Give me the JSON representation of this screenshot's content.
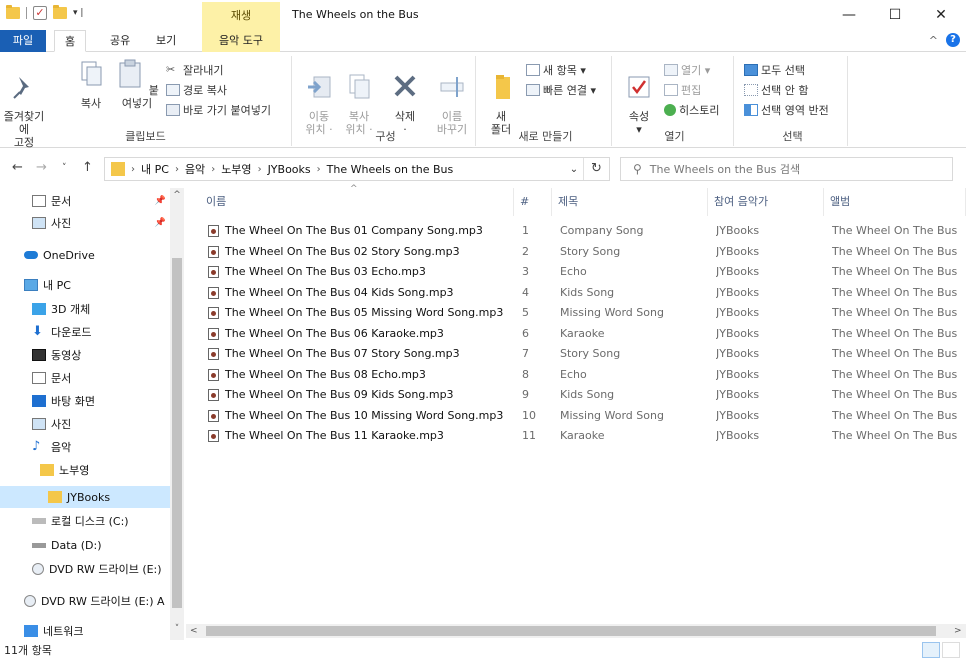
{
  "titlebar": {
    "context_tab_label": "재생",
    "title": "The Wheels on the Bus",
    "minimize": "—",
    "maximize": "☐",
    "close": "✕"
  },
  "ribbon_tabs": {
    "file": "파일",
    "home": "홈",
    "share": "공유",
    "view": "보기",
    "music_tools": "음악 도구",
    "collapse": "^",
    "help": "?"
  },
  "ribbon": {
    "clipboard": {
      "label": "클립보드",
      "pin_quick": "즐겨찾기에\n고정",
      "copy": "복사",
      "paste": "붙여넣기",
      "cut": "잘라내기",
      "copy_path": "경로 복사",
      "paste_shortcut": "바로 가기 붙여넣기"
    },
    "organize": {
      "label": "구성",
      "move_to": "이동\n위치 ·",
      "copy_to": "복사\n위치 ·",
      "delete": "삭제\n·",
      "rename": "이름\n바꾸기"
    },
    "new": {
      "label": "새로 만들기",
      "new_folder": "새\n폴더",
      "new_item": "새 항목 ▾",
      "easy_access": "빠른 연결 ▾"
    },
    "open": {
      "label": "열기",
      "properties": "속성\n▾",
      "open": "열기 ▾",
      "edit": "편집",
      "history": "히스토리"
    },
    "select": {
      "label": "선택",
      "select_all": "모두 선택",
      "select_none": "선택 안 함",
      "invert": "선택 영역 반전"
    }
  },
  "address": {
    "crumbs": [
      "내 PC",
      "음악",
      "노부영",
      "JYBooks",
      "The Wheels on the Bus"
    ],
    "search_placeholder": "The Wheels on the Bus 검색"
  },
  "nav": {
    "items": [
      {
        "label": "문서",
        "pinned": true
      },
      {
        "label": "사진",
        "pinned": true
      },
      {
        "label": "OneDrive"
      },
      {
        "label": "내 PC"
      },
      {
        "label": "3D 개체"
      },
      {
        "label": "다운로드"
      },
      {
        "label": "동영상"
      },
      {
        "label": "문서"
      },
      {
        "label": "바탕 화면"
      },
      {
        "label": "사진"
      },
      {
        "label": "음악"
      },
      {
        "label": "노부영"
      },
      {
        "label": "JYBooks"
      },
      {
        "label": "로컬 디스크 (C:)"
      },
      {
        "label": "Data (D:)"
      },
      {
        "label": "DVD RW 드라이브 (E:)"
      },
      {
        "label": "DVD RW 드라이브 (E:) A"
      },
      {
        "label": "네트워크"
      }
    ]
  },
  "columns": {
    "name": "이름",
    "number": "#",
    "title": "제목",
    "artist": "참여 음악가",
    "album": "앨범"
  },
  "files": [
    {
      "name": "The Wheel On The Bus 01 Company Song.mp3",
      "num": "1",
      "title": "Company Song",
      "artist": "JYBooks",
      "album": "The Wheel On The Bus"
    },
    {
      "name": "The Wheel On The Bus 02 Story Song.mp3",
      "num": "2",
      "title": "Story Song",
      "artist": "JYBooks",
      "album": "The Wheel On The Bus"
    },
    {
      "name": "The Wheel On The Bus 03 Echo.mp3",
      "num": "3",
      "title": "Echo",
      "artist": "JYBooks",
      "album": "The Wheel On The Bus"
    },
    {
      "name": "The Wheel On The Bus 04 Kids Song.mp3",
      "num": "4",
      "title": "Kids Song",
      "artist": "JYBooks",
      "album": "The Wheel On The Bus"
    },
    {
      "name": "The Wheel On The Bus 05 Missing Word Song.mp3",
      "num": "5",
      "title": "Missing Word Song",
      "artist": "JYBooks",
      "album": "The Wheel On The Bus"
    },
    {
      "name": "The Wheel On The Bus 06 Karaoke.mp3",
      "num": "6",
      "title": "Karaoke",
      "artist": "JYBooks",
      "album": "The Wheel On The Bus"
    },
    {
      "name": "The Wheel On The Bus 07 Story Song.mp3",
      "num": "7",
      "title": "Story Song",
      "artist": "JYBooks",
      "album": "The Wheel On The Bus"
    },
    {
      "name": "The Wheel On The Bus 08 Echo.mp3",
      "num": "8",
      "title": "Echo",
      "artist": "JYBooks",
      "album": "The Wheel On The Bus"
    },
    {
      "name": "The Wheel On The Bus 09 Kids Song.mp3",
      "num": "9",
      "title": "Kids Song",
      "artist": "JYBooks",
      "album": "The Wheel On The Bus"
    },
    {
      "name": "The Wheel On The Bus 10 Missing Word Song.mp3",
      "num": "10",
      "title": "Missing Word Song",
      "artist": "JYBooks",
      "album": "The Wheel On The Bus"
    },
    {
      "name": "The Wheel On The Bus 11 Karaoke.mp3",
      "num": "11",
      "title": "Karaoke",
      "artist": "JYBooks",
      "album": "The Wheel On The Bus"
    }
  ],
  "status": {
    "count": "11개 항목"
  }
}
